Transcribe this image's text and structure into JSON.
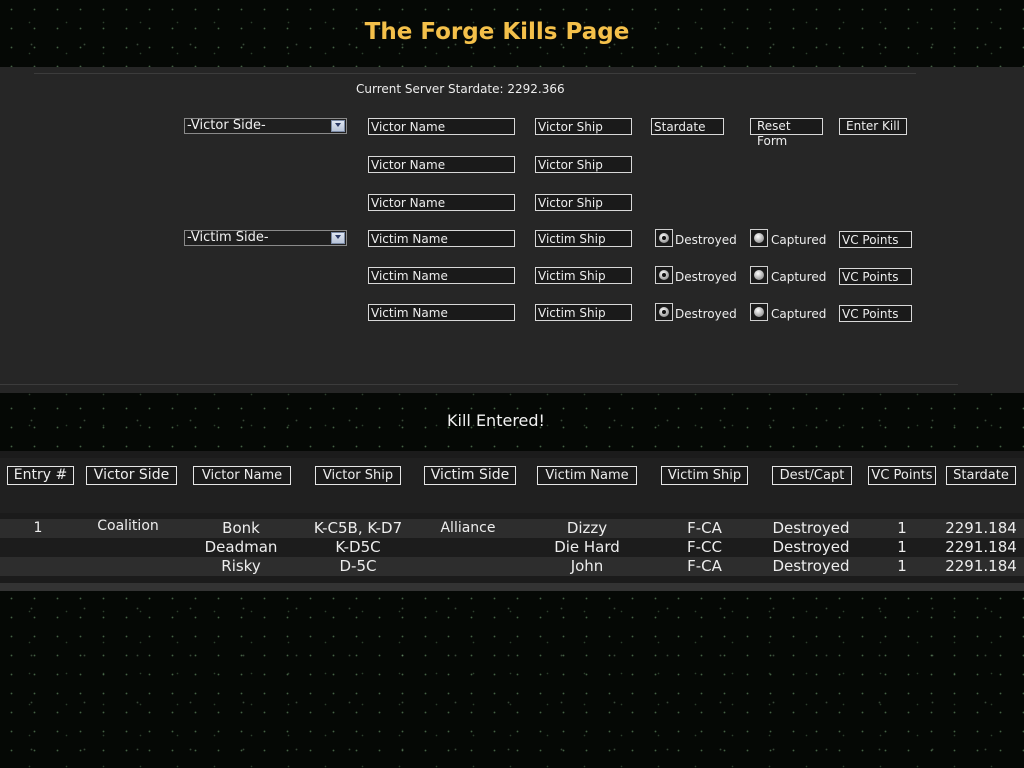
{
  "page": {
    "title": "The Forge Kills Page"
  },
  "form": {
    "stardate_text": "Current Server Stardate: 2292.366",
    "victor_side_select": "-Victor Side-",
    "victim_side_select": "-Victim Side-",
    "victor_rows": [
      {
        "name_placeholder": "Victor Name",
        "ship_placeholder": "Victor Ship"
      },
      {
        "name_placeholder": "Victor Name",
        "ship_placeholder": "Victor Ship"
      },
      {
        "name_placeholder": "Victor Name",
        "ship_placeholder": "Victor Ship"
      }
    ],
    "stardate_placeholder": "Stardate",
    "reset_label": "Reset Form",
    "enter_label": "Enter Kill",
    "victim_rows": [
      {
        "name_placeholder": "Victim Name",
        "ship_placeholder": "Victim Ship",
        "destroyed_label": "Destroyed",
        "captured_label": "Captured",
        "vc_placeholder": "VC Points",
        "destroyed_checked": true
      },
      {
        "name_placeholder": "Victim Name",
        "ship_placeholder": "Victim Ship",
        "destroyed_label": "Destroyed",
        "captured_label": "Captured",
        "vc_placeholder": "VC Points",
        "destroyed_checked": true
      },
      {
        "name_placeholder": "Victim Name",
        "ship_placeholder": "Victim Ship",
        "destroyed_label": "Destroyed",
        "captured_label": "Captured",
        "vc_placeholder": "VC Points",
        "destroyed_checked": true
      }
    ]
  },
  "message": "Kill Entered!",
  "table": {
    "headers": [
      "Entry #",
      "Victor Side",
      "Victor Name",
      "Victor Ship",
      "Victim Side",
      "Victim Name",
      "Victim Ship",
      "Dest/Capt",
      "VC Points",
      "Stardate"
    ],
    "rows": [
      [
        "1",
        "Coalition",
        "Bonk",
        "K-C5B, K-D7",
        "Alliance",
        "Dizzy",
        "F-CA",
        "Destroyed",
        "1",
        "2291.184"
      ],
      [
        "",
        "",
        "Deadman",
        "K-D5C",
        "",
        "Die Hard",
        "F-CC",
        "Destroyed",
        "1",
        "2291.184"
      ],
      [
        "",
        "",
        "Risky",
        "D-5C",
        "",
        "John",
        "F-CA",
        "Destroyed",
        "1",
        "2291.184"
      ]
    ]
  },
  "colors": {
    "title": "#f4c04a",
    "panel": "#262626",
    "text": "#ededed"
  },
  "icons": {
    "select_arrow": "chevron-down-icon",
    "radio": "radio-icon"
  }
}
